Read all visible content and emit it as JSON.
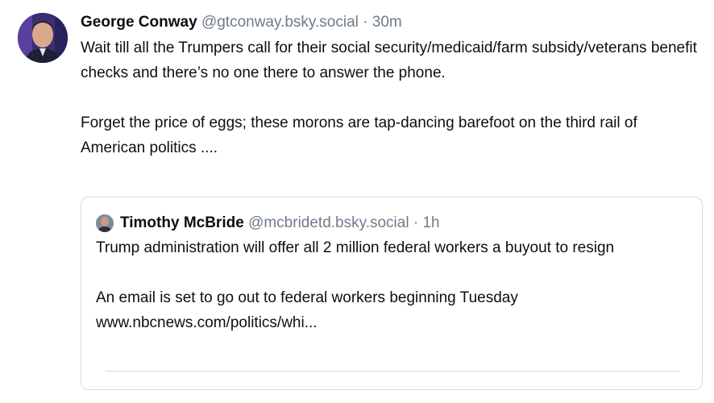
{
  "post": {
    "display_name": "George Conway",
    "handle": "@gtconway.bsky.social",
    "separator": "·",
    "time": "30m",
    "paragraphs": [
      "Wait till all the Trumpers call for their social security/medicaid/farm subsidy/veterans benefit checks and there’s no one there to answer the phone.",
      "Forget the price of eggs; these morons are tap-dancing barefoot on the third rail of American politics ...."
    ]
  },
  "quote": {
    "display_name": "Timothy McBride",
    "handle": "@mcbridetd.bsky.social",
    "separator": "·",
    "time": "1h",
    "paragraphs": [
      "Trump administration will offer all 2 million federal workers a buyout to resign",
      "An email is set to go out to federal workers beginning Tuesday",
      "www.nbcnews.com/politics/whi..."
    ]
  }
}
